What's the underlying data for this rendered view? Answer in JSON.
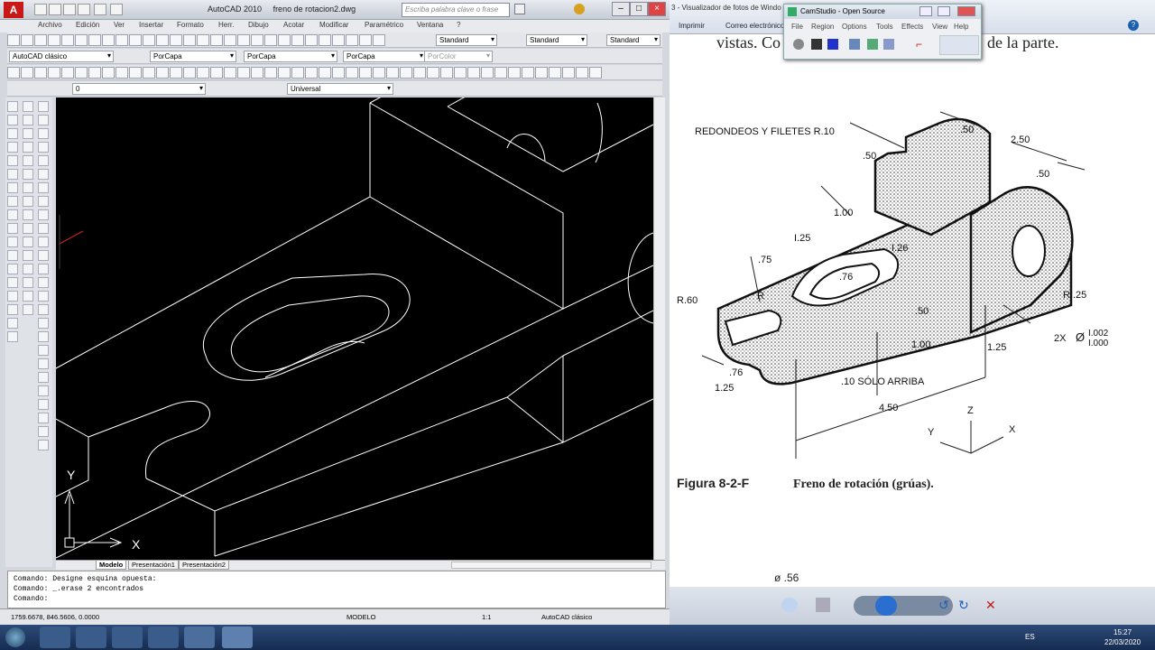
{
  "acad": {
    "window_title": "AutoCAD 2010",
    "file_title": "freno de rotacion2.dwg",
    "search_placeholder": "Escriba palabra clave o frase",
    "menu": [
      "Archivo",
      "Edición",
      "Ver",
      "Insertar",
      "Formato",
      "Herr.",
      "Dibujo",
      "Acotar",
      "Modificar",
      "Paramétrico",
      "Ventana",
      "?"
    ],
    "workspace": "AutoCAD clásico",
    "text_style": "Standard",
    "dim_style": "Standard",
    "table_style": "Standard",
    "color_combo": "PorCapa",
    "linetype_combo": "PorCapa",
    "lineweight_combo": "PorCapa",
    "plotstyle_combo": "PorColor",
    "layer_combo": "0",
    "ucs_combo": "Universal",
    "tabs": [
      "Modelo",
      "Presentación1",
      "Presentación2"
    ],
    "cmd_lines": [
      "Comando: Designe esquina opuesta:",
      "Comando: _.erase 2 encontrados",
      "Comando:"
    ],
    "coords": "1759.6678, 846.5606, 0.0000",
    "status_modelo": "MODELO",
    "status_scale": "1:1",
    "status_workspace": "AutoCAD clásico",
    "ucs_x": "X",
    "ucs_y": "Y"
  },
  "viewer": {
    "title": "3 - Visualizador de fotos de Windo",
    "menu": [
      "Imprimir",
      "Correo electrónico"
    ],
    "help": "?",
    "top_text_left": "vistas. Co",
    "top_text_right": "de la parte.",
    "note": "REDONDEOS Y FILETES R.10",
    "dims": {
      "d50a": ".50",
      "d250": "2.50",
      "d50b": ".50",
      "d50c": ".50",
      "d100a": "1.00",
      "d125a": "I.25",
      "d126": "I.26",
      "d75": ".75",
      "d76a": ".76",
      "d76b": ".76",
      "dR": "R",
      "dR60": "R.60",
      "dR125": "RI.25",
      "d2x": "2X",
      "dphi": "Ø",
      "tol_hi": "I.002",
      "tol_lo": "I.000",
      "d50d": ".50",
      "d100b": "1.00",
      "d125b": "1.25",
      "d125c": "1.25",
      "d10": ".10 SÓLO ARRIBA",
      "d450": "4.50"
    },
    "axes": {
      "z": "Z",
      "x": "X",
      "y": "Y"
    },
    "fig_label": "Figura 8-2-F",
    "fig_caption": "Freno de rotación (grúas).",
    "bottom_text": "ø .56"
  },
  "camstudio": {
    "title": "CamStudio - Open Source",
    "menu": [
      "File",
      "Region",
      "Options",
      "Tools",
      "Effects",
      "View",
      "Help"
    ]
  },
  "taskbar": {
    "lang": "ES",
    "time": "15:27",
    "date": "22/03/2020"
  }
}
